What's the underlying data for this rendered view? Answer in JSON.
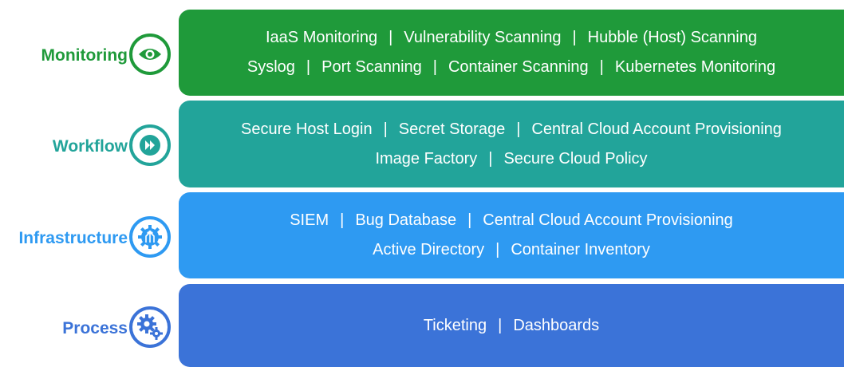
{
  "layers": [
    {
      "label": "Monitoring",
      "icon": "eye-icon",
      "color": "#1f9a3a",
      "label_color": "#1f9a3a",
      "lines": [
        [
          "IaaS Monitoring",
          "Vulnerability Scanning",
          "Hubble (Host) Scanning"
        ],
        [
          "Syslog",
          "Port Scanning",
          "Container Scanning",
          "Kubernetes Monitoring"
        ]
      ]
    },
    {
      "label": "Workflow",
      "icon": "fast-forward-icon",
      "color": "#22a49a",
      "label_color": "#22a49a",
      "lines": [
        [
          "Secure Host Login",
          "Secret Storage",
          "Central Cloud Account Provisioning"
        ],
        [
          "Image Factory",
          "Secure Cloud Policy"
        ]
      ]
    },
    {
      "label": "Infrastructure",
      "icon": "gear-circuit-icon",
      "color": "#2e9af2",
      "label_color": "#2e9af2",
      "lines": [
        [
          "SIEM",
          "Bug Database",
          "Central Cloud Account Provisioning"
        ],
        [
          "Active Directory",
          "Container Inventory"
        ]
      ]
    },
    {
      "label": "Process",
      "icon": "gears-icon",
      "color": "#3b73d8",
      "label_color": "#3b73d8",
      "lines": [
        [
          "Ticketing",
          "Dashboards"
        ]
      ]
    }
  ],
  "separator": "|"
}
